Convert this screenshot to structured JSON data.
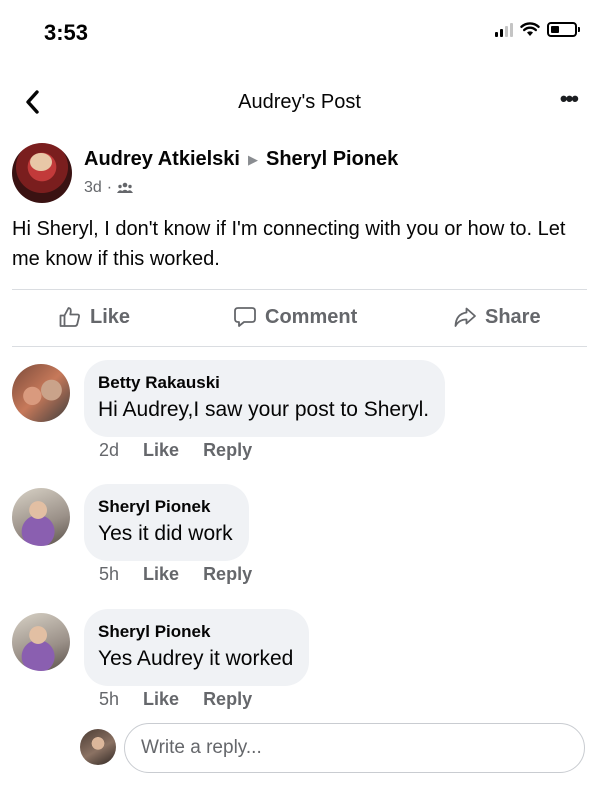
{
  "status_bar": {
    "time": "3:53"
  },
  "nav": {
    "title": "Audrey's Post"
  },
  "post": {
    "author": "Audrey Atkielski",
    "recipient": "Sheryl Pionek",
    "age": "3d",
    "separator": "·",
    "text": "Hi Sheryl,  I don't know if I'm connecting with you or how to. Let me know if this worked."
  },
  "actions": {
    "like": "Like",
    "comment": "Comment",
    "share": "Share"
  },
  "comments": [
    {
      "name": "Betty Rakauski",
      "text": "Hi Audrey,I saw your post to Sheryl.",
      "age": "2d",
      "like": "Like",
      "reply": "Reply"
    },
    {
      "name": "Sheryl Pionek",
      "text": "Yes it did work",
      "age": "5h",
      "like": "Like",
      "reply": "Reply"
    },
    {
      "name": "Sheryl Pionek",
      "text": "Yes Audrey it worked",
      "age": "5h",
      "like": "Like",
      "reply": "Reply"
    }
  ],
  "reply": {
    "placeholder": "Write a reply..."
  },
  "icons": [
    "signal-icon",
    "wifi-icon",
    "battery-icon",
    "back-icon",
    "more-icon",
    "arrow-icon",
    "friends-icon",
    "like-icon",
    "comment-icon",
    "share-icon"
  ]
}
